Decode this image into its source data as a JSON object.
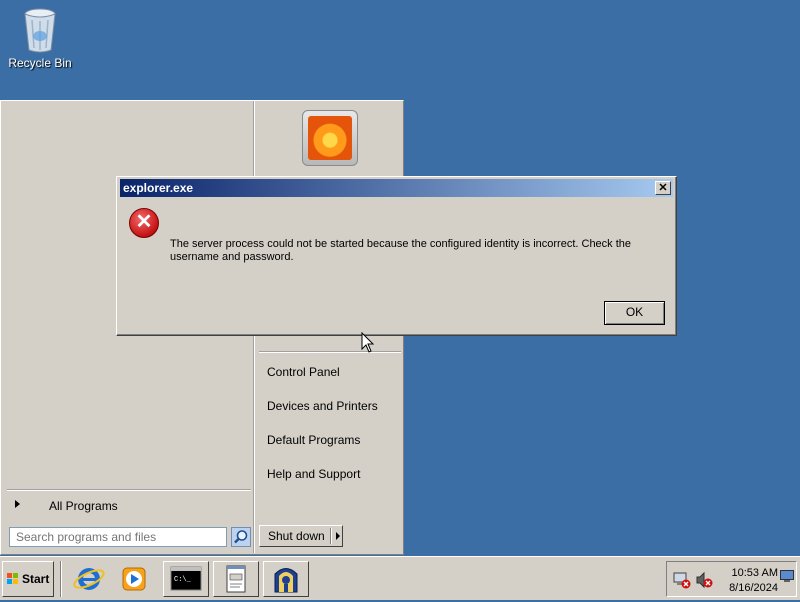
{
  "desktop": {
    "icons": [
      {
        "label": "Recycle Bin",
        "icon": "recycle-bin-icon"
      }
    ]
  },
  "start_menu": {
    "all_programs_label": "All Programs",
    "search_placeholder": "Search programs and files",
    "right_items": [
      {
        "label": "Control Panel"
      },
      {
        "label": "Devices and Printers"
      },
      {
        "label": "Default Programs"
      },
      {
        "label": "Help and Support"
      }
    ],
    "shutdown_label": "Shut down"
  },
  "dialog": {
    "title": "explorer.exe",
    "close_glyph": "✕",
    "icon": "error-icon",
    "message": "The server process could not be started because the configured identity is incorrect. Check the username and password.",
    "ok_label": "OK"
  },
  "taskbar": {
    "start_label": "Start",
    "pinned": [
      "internet-explorer-icon",
      "media-player-icon",
      "command-prompt-icon",
      "notepad-icon",
      "app-icon"
    ],
    "tray": {
      "time": "10:53 AM",
      "date": "8/16/2024",
      "icons": [
        "network-error-icon",
        "volume-muted-icon"
      ]
    }
  },
  "colors": {
    "desktop_background": "#3a6ea5",
    "titlebar_start": "#0a246a",
    "titlebar_end": "#a6caf0",
    "window_face": "#d4d0c8"
  }
}
